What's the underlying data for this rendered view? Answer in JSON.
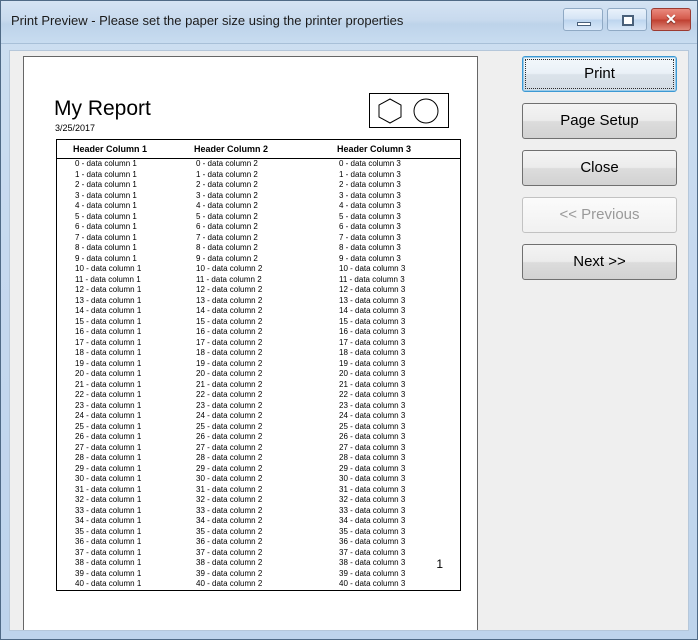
{
  "window": {
    "title": "Print Preview - Please set the paper size using the printer properties",
    "controls": {
      "minimize_label": "minimize-icon",
      "restore_label": "restore-icon",
      "close_label": "✕"
    }
  },
  "report": {
    "title": "My Report",
    "date": "3/25/2017",
    "shapes": [
      "hexagon",
      "circle"
    ],
    "page_number": "1",
    "table": {
      "headers": [
        "Header Column 1",
        "Header Column 2",
        "Header Column 3"
      ],
      "row_count": 41,
      "row_template": "{i} - data column {c}",
      "rows": [
        [
          "0 - data column 1",
          "0 - data column 2",
          "0 - data column 3"
        ],
        [
          "1 - data column 1",
          "1 - data column 2",
          "1 - data column 3"
        ],
        [
          "2 - data column 1",
          "2 - data column 2",
          "2 - data column 3"
        ],
        [
          "3 - data column 1",
          "3 - data column 2",
          "3 - data column 3"
        ],
        [
          "4 - data column 1",
          "4 - data column 2",
          "4 - data column 3"
        ],
        [
          "5 - data column 1",
          "5 - data column 2",
          "5 - data column 3"
        ],
        [
          "6 - data column 1",
          "6 - data column 2",
          "6 - data column 3"
        ],
        [
          "7 - data column 1",
          "7 - data column 2",
          "7 - data column 3"
        ],
        [
          "8 - data column 1",
          "8 - data column 2",
          "8 - data column 3"
        ],
        [
          "9 - data column 1",
          "9 - data column 2",
          "9 - data column 3"
        ],
        [
          "10 - data column 1",
          "10 - data column 2",
          "10 - data column 3"
        ],
        [
          "11 - data column 1",
          "11 - data column 2",
          "11 - data column 3"
        ],
        [
          "12 - data column 1",
          "12 - data column 2",
          "12 - data column 3"
        ],
        [
          "13 - data column 1",
          "13 - data column 2",
          "13 - data column 3"
        ],
        [
          "14 - data column 1",
          "14 - data column 2",
          "14 - data column 3"
        ],
        [
          "15 - data column 1",
          "15 - data column 2",
          "15 - data column 3"
        ],
        [
          "16 - data column 1",
          "16 - data column 2",
          "16 - data column 3"
        ],
        [
          "17 - data column 1",
          "17 - data column 2",
          "17 - data column 3"
        ],
        [
          "18 - data column 1",
          "18 - data column 2",
          "18 - data column 3"
        ],
        [
          "19 - data column 1",
          "19 - data column 2",
          "19 - data column 3"
        ],
        [
          "20 - data column 1",
          "20 - data column 2",
          "20 - data column 3"
        ],
        [
          "21 - data column 1",
          "21 - data column 2",
          "21 - data column 3"
        ],
        [
          "22 - data column 1",
          "22 - data column 2",
          "22 - data column 3"
        ],
        [
          "23 - data column 1",
          "23 - data column 2",
          "23 - data column 3"
        ],
        [
          "24 - data column 1",
          "24 - data column 2",
          "24 - data column 3"
        ],
        [
          "25 - data column 1",
          "25 - data column 2",
          "25 - data column 3"
        ],
        [
          "26 - data column 1",
          "26 - data column 2",
          "26 - data column 3"
        ],
        [
          "27 - data column 1",
          "27 - data column 2",
          "27 - data column 3"
        ],
        [
          "28 - data column 1",
          "28 - data column 2",
          "28 - data column 3"
        ],
        [
          "29 - data column 1",
          "29 - data column 2",
          "29 - data column 3"
        ],
        [
          "30 - data column 1",
          "30 - data column 2",
          "30 - data column 3"
        ],
        [
          "31 - data column 1",
          "31 - data column 2",
          "31 - data column 3"
        ],
        [
          "32 - data column 1",
          "32 - data column 2",
          "32 - data column 3"
        ],
        [
          "33 - data column 1",
          "33 - data column 2",
          "33 - data column 3"
        ],
        [
          "34 - data column 1",
          "34 - data column 2",
          "34 - data column 3"
        ],
        [
          "35 - data column 1",
          "35 - data column 2",
          "35 - data column 3"
        ],
        [
          "36 - data column 1",
          "36 - data column 2",
          "36 - data column 3"
        ],
        [
          "37 - data column 1",
          "37 - data column 2",
          "37 - data column 3"
        ],
        [
          "38 - data column 1",
          "38 - data column 2",
          "38 - data column 3"
        ],
        [
          "39 - data column 1",
          "39 - data column 2",
          "39 - data column 3"
        ],
        [
          "40 - data column 1",
          "40 - data column 2",
          "40 - data column 3"
        ]
      ]
    }
  },
  "buttons": [
    {
      "label": "Print",
      "name": "print-button",
      "state": "focused"
    },
    {
      "label": "Page Setup",
      "name": "page-setup-button",
      "state": "normal"
    },
    {
      "label": "Close",
      "name": "close-button",
      "state": "normal"
    },
    {
      "label": "<< Previous",
      "name": "previous-page-button",
      "state": "disabled"
    },
    {
      "label": "Next >>",
      "name": "next-page-button",
      "state": "normal"
    }
  ],
  "colors": {
    "titlebar": "#c6d9ef",
    "frame_border": "#4f6a86",
    "client_bg": "#efefef",
    "page_bg": "#ffffff",
    "focus_accent": "#3c99d4",
    "close_button": "#c0392b",
    "disabled_text": "#9a9a9a"
  }
}
